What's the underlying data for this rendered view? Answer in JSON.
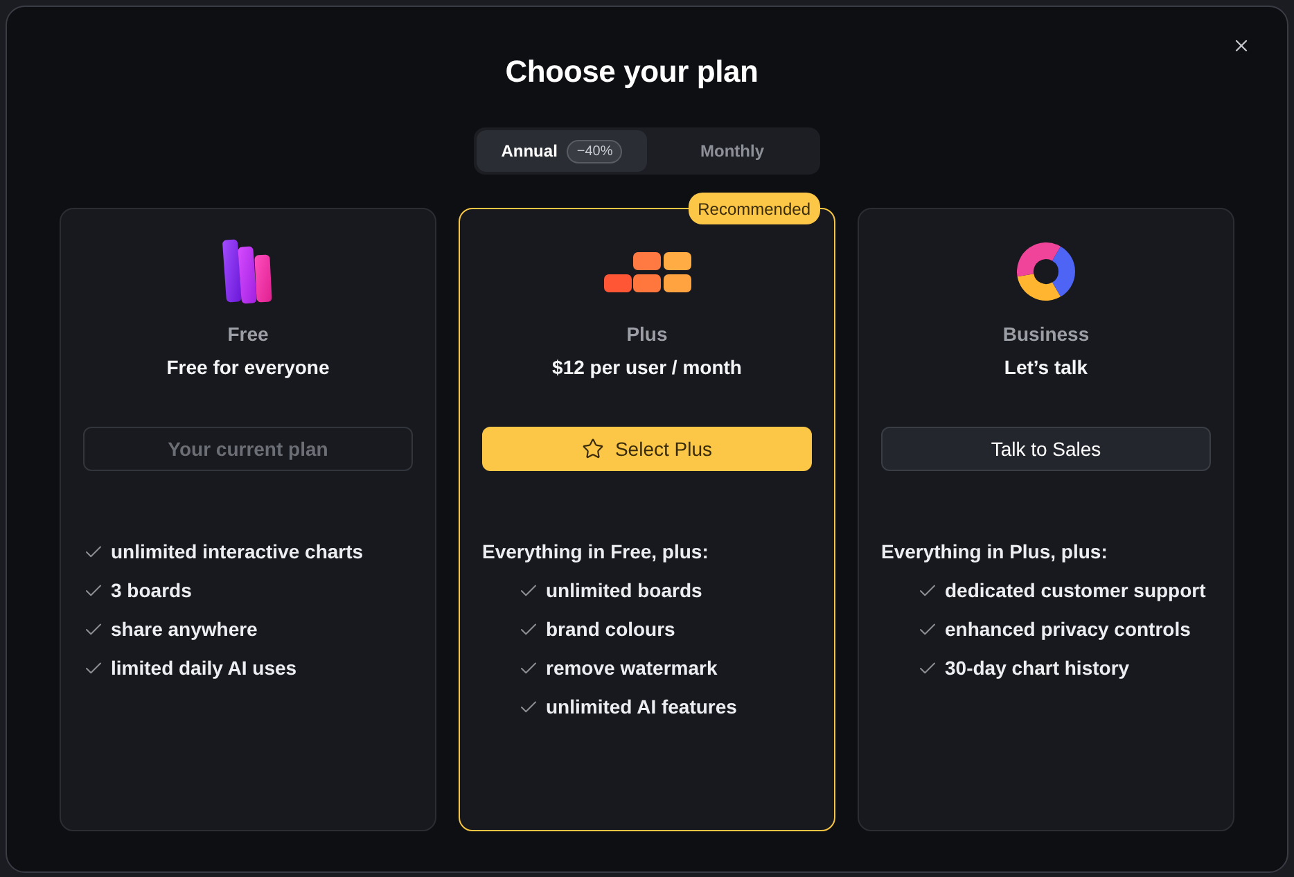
{
  "dialog": {
    "title": "Choose your plan"
  },
  "billing_tabs": [
    {
      "label": "Annual",
      "badge": "−40%",
      "selected": true
    },
    {
      "label": "Monthly",
      "selected": false
    }
  ],
  "plans": [
    {
      "kind": "free",
      "name": "Free",
      "price": "Free for everyone",
      "highlighted": false,
      "button": {
        "label": "Your current plan",
        "kind": "current"
      },
      "features": [
        "unlimited interactive charts",
        "3 boards",
        "share anywhere",
        "limited daily AI uses"
      ]
    },
    {
      "kind": "plus",
      "name": "Plus",
      "price": "$12 per user / month",
      "highlighted": true,
      "badge": "Recommended",
      "button": {
        "label": "Select Plus",
        "kind": "primary"
      },
      "intro": "Everything in Free, plus:",
      "features": [
        "unlimited boards",
        "brand colours",
        "remove watermark",
        "unlimited AI features"
      ]
    },
    {
      "kind": "business",
      "name": "Business",
      "price": "Let’s talk",
      "highlighted": false,
      "button": {
        "label": "Talk to Sales",
        "kind": "secondary"
      },
      "intro": "Everything in Plus, plus:",
      "features": [
        "dedicated customer support",
        "enhanced privacy controls",
        "30-day chart history"
      ]
    }
  ]
}
